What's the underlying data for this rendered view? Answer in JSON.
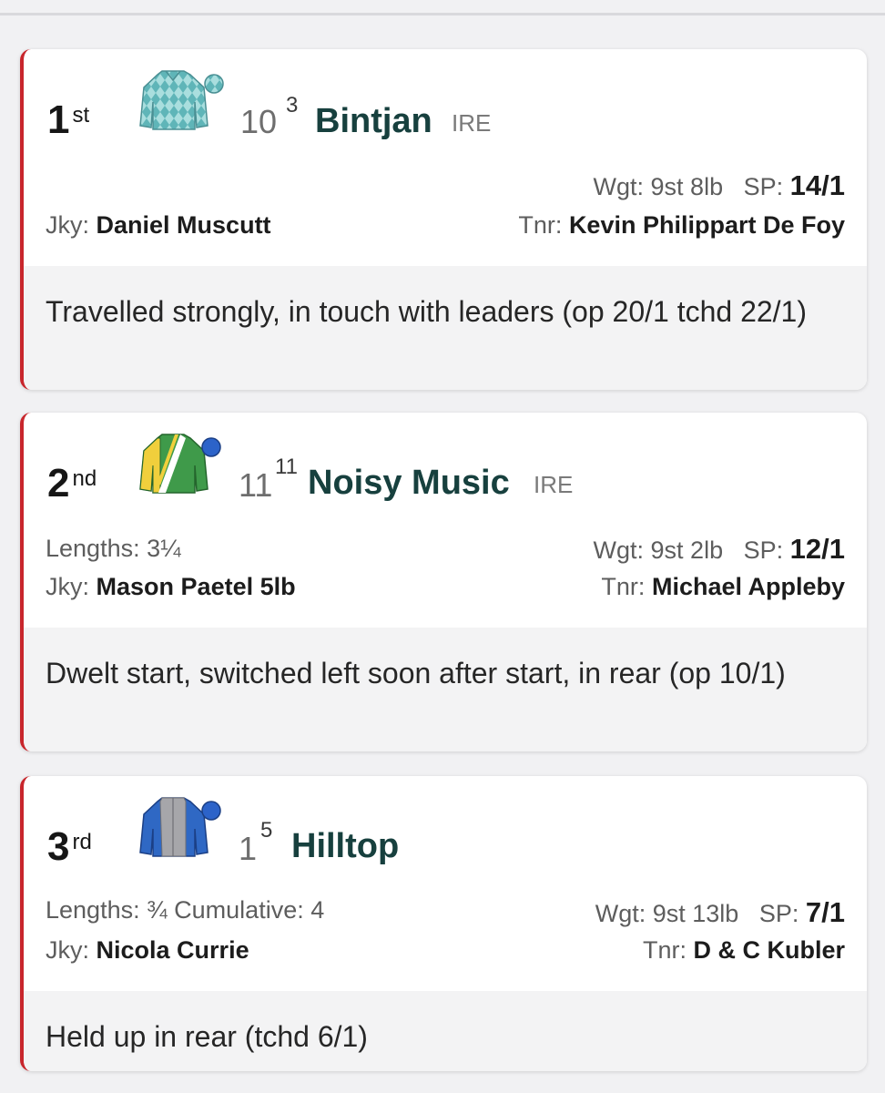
{
  "runners": [
    {
      "position": "1",
      "suffix": "st",
      "silks_icon": "silks-teal-diamonds-icon",
      "cloth": "10",
      "draw": "3",
      "name": "Bintjan",
      "country": "IRE",
      "lengths_label": "",
      "lengths": "",
      "cumulative_label": "",
      "cumulative": "",
      "weight_label": "Wgt:",
      "weight": "9st 8lb",
      "sp_label": "SP:",
      "sp": "14/1",
      "jockey_label": "Jky:",
      "jockey": "Daniel Muscutt",
      "trainer_label": "Tnr:",
      "trainer": "Kevin Philippart De Foy",
      "comment": "Travelled strongly, in touch with leaders (op 20/1 tchd 22/1)"
    },
    {
      "position": "2",
      "suffix": "nd",
      "silks_icon": "silks-yellow-green-stripes-icon",
      "cloth": "11",
      "draw": "11",
      "name": "Noisy Music",
      "country": "IRE",
      "lengths_label": "Lengths:",
      "lengths": "3¼",
      "cumulative_label": "",
      "cumulative": "",
      "weight_label": "Wgt:",
      "weight": "9st 2lb",
      "sp_label": "SP:",
      "sp": "12/1",
      "jockey_label": "Jky:",
      "jockey": "Mason Paetel",
      "jockey_claim": "5lb",
      "trainer_label": "Tnr:",
      "trainer": "Michael Appleby",
      "comment": "Dwelt start, switched left soon after start, in rear (op 10/1)"
    },
    {
      "position": "3",
      "suffix": "rd",
      "silks_icon": "silks-blue-grey-icon",
      "cloth": "1",
      "draw": "5",
      "name": "Hilltop",
      "country": "",
      "lengths_label": "Lengths:",
      "lengths": "¾",
      "cumulative_label": "Cumulative:",
      "cumulative": "4",
      "weight_label": "Wgt:",
      "weight": "9st 13lb",
      "sp_label": "SP:",
      "sp": "7/1",
      "jockey_label": "Jky:",
      "jockey": "Nicola Currie",
      "trainer_label": "Tnr:",
      "trainer": "D & C Kubler",
      "comment": "Held up in rear (tchd 6/1)"
    }
  ],
  "colors": {
    "accent_red": "#c8262c",
    "horse_name": "#17403e",
    "comment_bg": "#f3f3f4"
  }
}
